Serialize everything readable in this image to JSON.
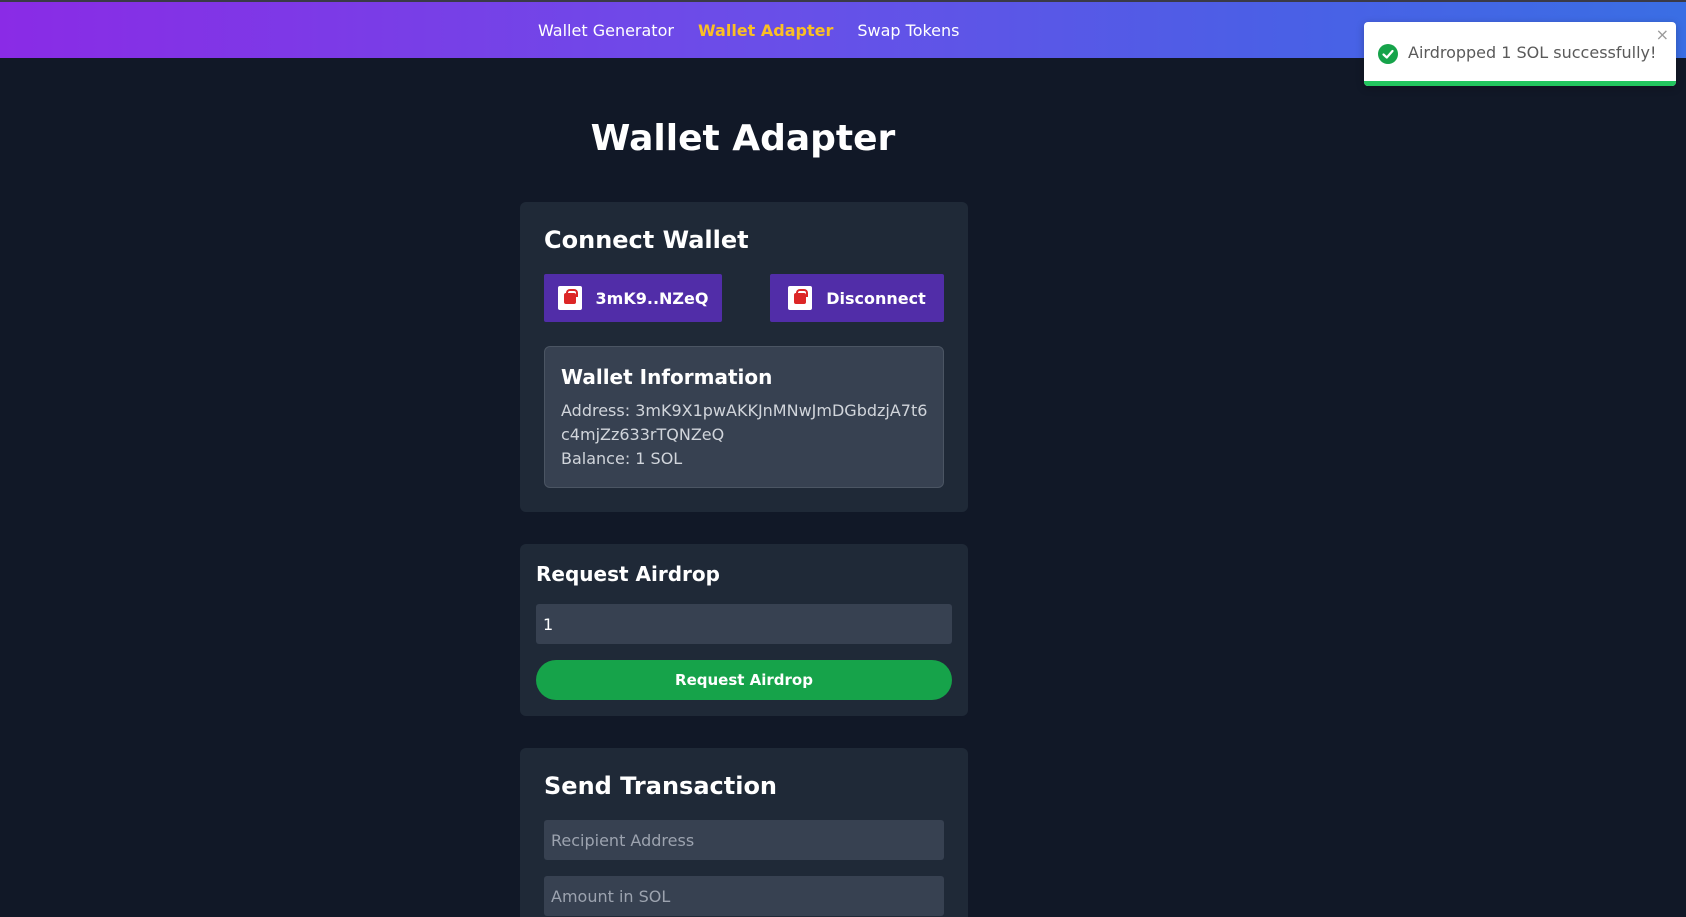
{
  "nav": {
    "links": [
      {
        "label": "Wallet Generator",
        "active": false
      },
      {
        "label": "Wallet Adapter",
        "active": true
      },
      {
        "label": "Swap Tokens",
        "active": false
      }
    ]
  },
  "toast": {
    "message": "Airdropped 1 SOL successfully!",
    "close": "×",
    "status_color": "#16a34a",
    "progress": 1.0
  },
  "page": {
    "title": "Wallet Adapter"
  },
  "connect": {
    "title": "Connect Wallet",
    "wallet_button": "3mK9..NZeQ",
    "disconnect_button": "Disconnect",
    "info": {
      "title": "Wallet Information",
      "address_line1": "Address: 3mK9X1pwAKKJnMNwJmDGbdzjA7t6",
      "address_line2": "c4mjZz633rTQNZeQ",
      "balance": "Balance: 1 SOL"
    }
  },
  "airdrop": {
    "title": "Request Airdrop",
    "amount_value": "1",
    "button": "Request Airdrop"
  },
  "send": {
    "title": "Send Transaction",
    "recipient_placeholder": "Recipient Address",
    "amount_placeholder": "Amount in SOL"
  },
  "colors": {
    "background": "#111827",
    "card": "#1f2937",
    "accent_active_nav": "#fbbf24",
    "wallet_button": "#512da8",
    "airdrop_button": "#16a34a"
  }
}
